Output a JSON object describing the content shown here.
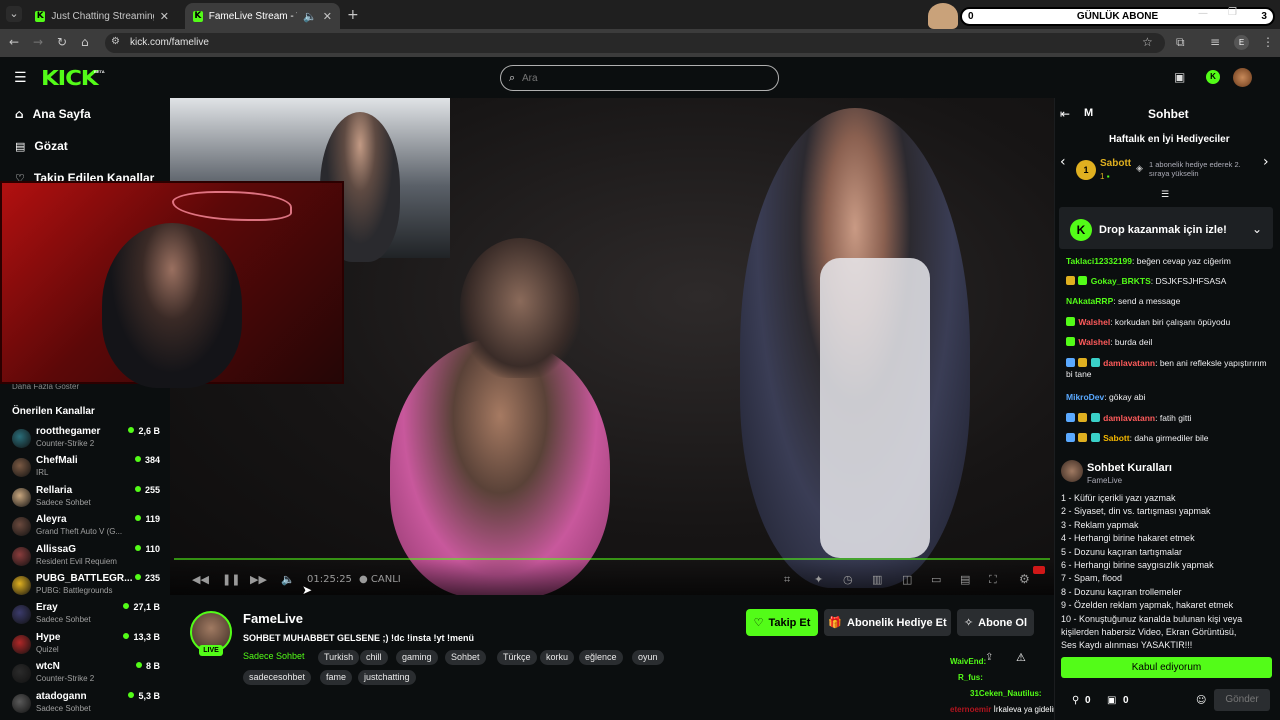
{
  "browser": {
    "tabs": [
      {
        "title": "Just Chatting Streaming - Live S"
      },
      {
        "title": "FameLive Stream - Watch Li"
      }
    ],
    "url": "kick.com/famelive",
    "widget": {
      "count_left": "0",
      "title": "GÜNLÜK ABONE",
      "count_right": "3"
    },
    "profile_initial": "E"
  },
  "header": {
    "logo": "KICK",
    "logo_beta": "BETA",
    "search_placeholder": "Ara"
  },
  "sidebar": {
    "nav": [
      {
        "label": "Ana Sayfa",
        "icon": "home-icon"
      },
      {
        "label": "Gözat",
        "icon": "browse-icon"
      },
      {
        "label": "Takip Edilen Kanallar",
        "icon": "heart-icon"
      }
    ],
    "show_more": "Daha Fazla Göster",
    "recommended_title": "Önerilen Kanallar",
    "channels": [
      {
        "name": "rootthegamer",
        "category": "Counter-Strike 2",
        "viewers": "2,6 B",
        "color": "#2a6e7a"
      },
      {
        "name": "ChefMali",
        "category": "IRL",
        "viewers": "384",
        "color": "#7b5a44"
      },
      {
        "name": "Rellaria",
        "category": "Sadece Sohbet",
        "viewers": "255",
        "color": "#c9a77f"
      },
      {
        "name": "Aleyra",
        "category": "Grand Theft Auto V (G...",
        "viewers": "119",
        "color": "#6b4a3e"
      },
      {
        "name": "AllissaG",
        "category": "Resident Evil Requiem",
        "viewers": "110",
        "color": "#8a3d3d"
      },
      {
        "name": "PUBG_BATTLEGR...",
        "category": "PUBG: Battlegrounds",
        "viewers": "235",
        "color": "#e0b020"
      },
      {
        "name": "Eray",
        "category": "Sadece Sohbet",
        "viewers": "27,1 B",
        "color": "#3b3b6b"
      },
      {
        "name": "Hype",
        "category": "Quizel",
        "viewers": "13,3 B",
        "color": "#b02828"
      },
      {
        "name": "wtcN",
        "category": "Counter-Strike 2",
        "viewers": "8 B",
        "color": "#2b2b2b"
      },
      {
        "name": "atadogann",
        "category": "Sadece Sohbet",
        "viewers": "5,3 B",
        "color": "#5a5a5a"
      }
    ]
  },
  "player": {
    "time": "01:25:25",
    "live_label": "CANLI"
  },
  "stream": {
    "streamer": "FameLive",
    "live_badge": "LIVE",
    "title": "SOHBET MUHABBET GELSENE ;) !dc !insta !yt !menü",
    "category": "Sadece Sohbet",
    "tags_row1": [
      "Turkish",
      "chill",
      "gaming",
      "Sohbet",
      "Türkçe",
      "korku",
      "eğlence",
      "oyun"
    ],
    "tags_row2": [
      "sadecesohbet",
      "fame",
      "justchatting"
    ],
    "follow_btn": "Takip Et",
    "gift_btn": "Abonelik Hediye Et",
    "sub_btn": "Abone Ol"
  },
  "chat": {
    "collapse_label": "M",
    "title": "Sohbet",
    "gifters": {
      "title": "Haftalık en İyi Hediyeciler",
      "rank": "1",
      "name": "Sabott",
      "count": "1",
      "note": "1 abonelik hediye ederek 2. sıraya yükselin"
    },
    "drop": "Drop kazanmak için izle!",
    "messages": [
      {
        "user": "Taklaci12332199",
        "color": "#53fc18",
        "text": "beğen cevap yaz ciğerim"
      },
      {
        "user": "Gokay_BRKTS",
        "color": "#53fc18",
        "text": "DSJKFSJHFSASA"
      },
      {
        "user": "NAkataRRP",
        "color": "#53fc18",
        "text": "send a message"
      },
      {
        "user": "Walshel",
        "color": "#ff5b5b",
        "text": "korkudan biri çalışanı öpüyodu"
      },
      {
        "user": "Walshel",
        "color": "#ff5b5b",
        "text": "burda deil"
      },
      {
        "user": "damlavatann",
        "color": "#ff5b5b",
        "text": "ben ani refleksle yapıştırırım bi tane"
      },
      {
        "user": "MikroDev",
        "color": "#5aa9ff",
        "text": "gökay abi"
      },
      {
        "user": "damlavatann",
        "color": "#ff5b5b",
        "text": "fatih gitti"
      },
      {
        "user": "Sabott",
        "color": "#f5b800",
        "text": "daha girmediler bile"
      }
    ],
    "rules": {
      "title": "Sohbet Kuralları",
      "subtitle": "FameLive",
      "items": [
        "1 - Küfür içerikli yazı yazmak",
        "2 - Siyaset, din vs. tartışması yapmak",
        "3 - Reklam yapmak",
        "4 - Herhangi birine hakaret etmek",
        "5 - Dozunu kaçıran tartışmalar",
        "6 - Herhangi birine saygısızlık yapmak",
        "7 - Spam, flood",
        "8 - Dozunu kaçıran trollemeler",
        "9 - Özelden reklam yapmak, hakaret etmek",
        "10 - Konuştuğunuz kanalda bulunan kişi veya",
        "kişilerden habersiz Video, Ekran Görüntüsü,",
        "Ses Kaydı alınması YASAKTIR!!!"
      ],
      "accept": "Kabul ediyorum"
    },
    "footer": {
      "points": "0",
      "gifts": "0",
      "send": "Gönder"
    }
  },
  "activity": [
    {
      "user": "WaivEnd:"
    },
    {
      "user": "R_fus:"
    },
    {
      "user": "31Ceken_Nautilus:"
    },
    {
      "user": "eternoemir",
      "text": "İrkaleva ya gidelim"
    }
  ],
  "colors": {
    "accent": "#53fc18",
    "bg": "#0b0e0f"
  }
}
